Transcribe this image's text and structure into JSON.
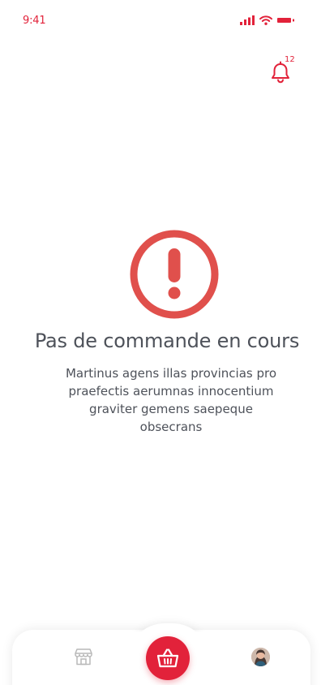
{
  "status_bar": {
    "time": "9:41",
    "icons": [
      "signal-icon",
      "wifi-icon",
      "battery-icon"
    ]
  },
  "header": {
    "notifications_icon": "bell-icon",
    "notifications_count": "12"
  },
  "empty_state": {
    "icon": "alert-circle-icon",
    "title": "Pas de commande en cours",
    "description": "Martinus agens illas provincias pro praefectis aerumnas innocentium graviter gemens saepeque obsecrans"
  },
  "bottom_nav": {
    "items": [
      {
        "icon": "shop-icon"
      },
      {
        "icon": "basket-icon",
        "active": true
      },
      {
        "icon": "avatar"
      }
    ]
  },
  "colors": {
    "accent": "#e2223a",
    "alert": "#e0504c",
    "text": "#4e525a",
    "nav_icon": "#b9b9b9"
  }
}
